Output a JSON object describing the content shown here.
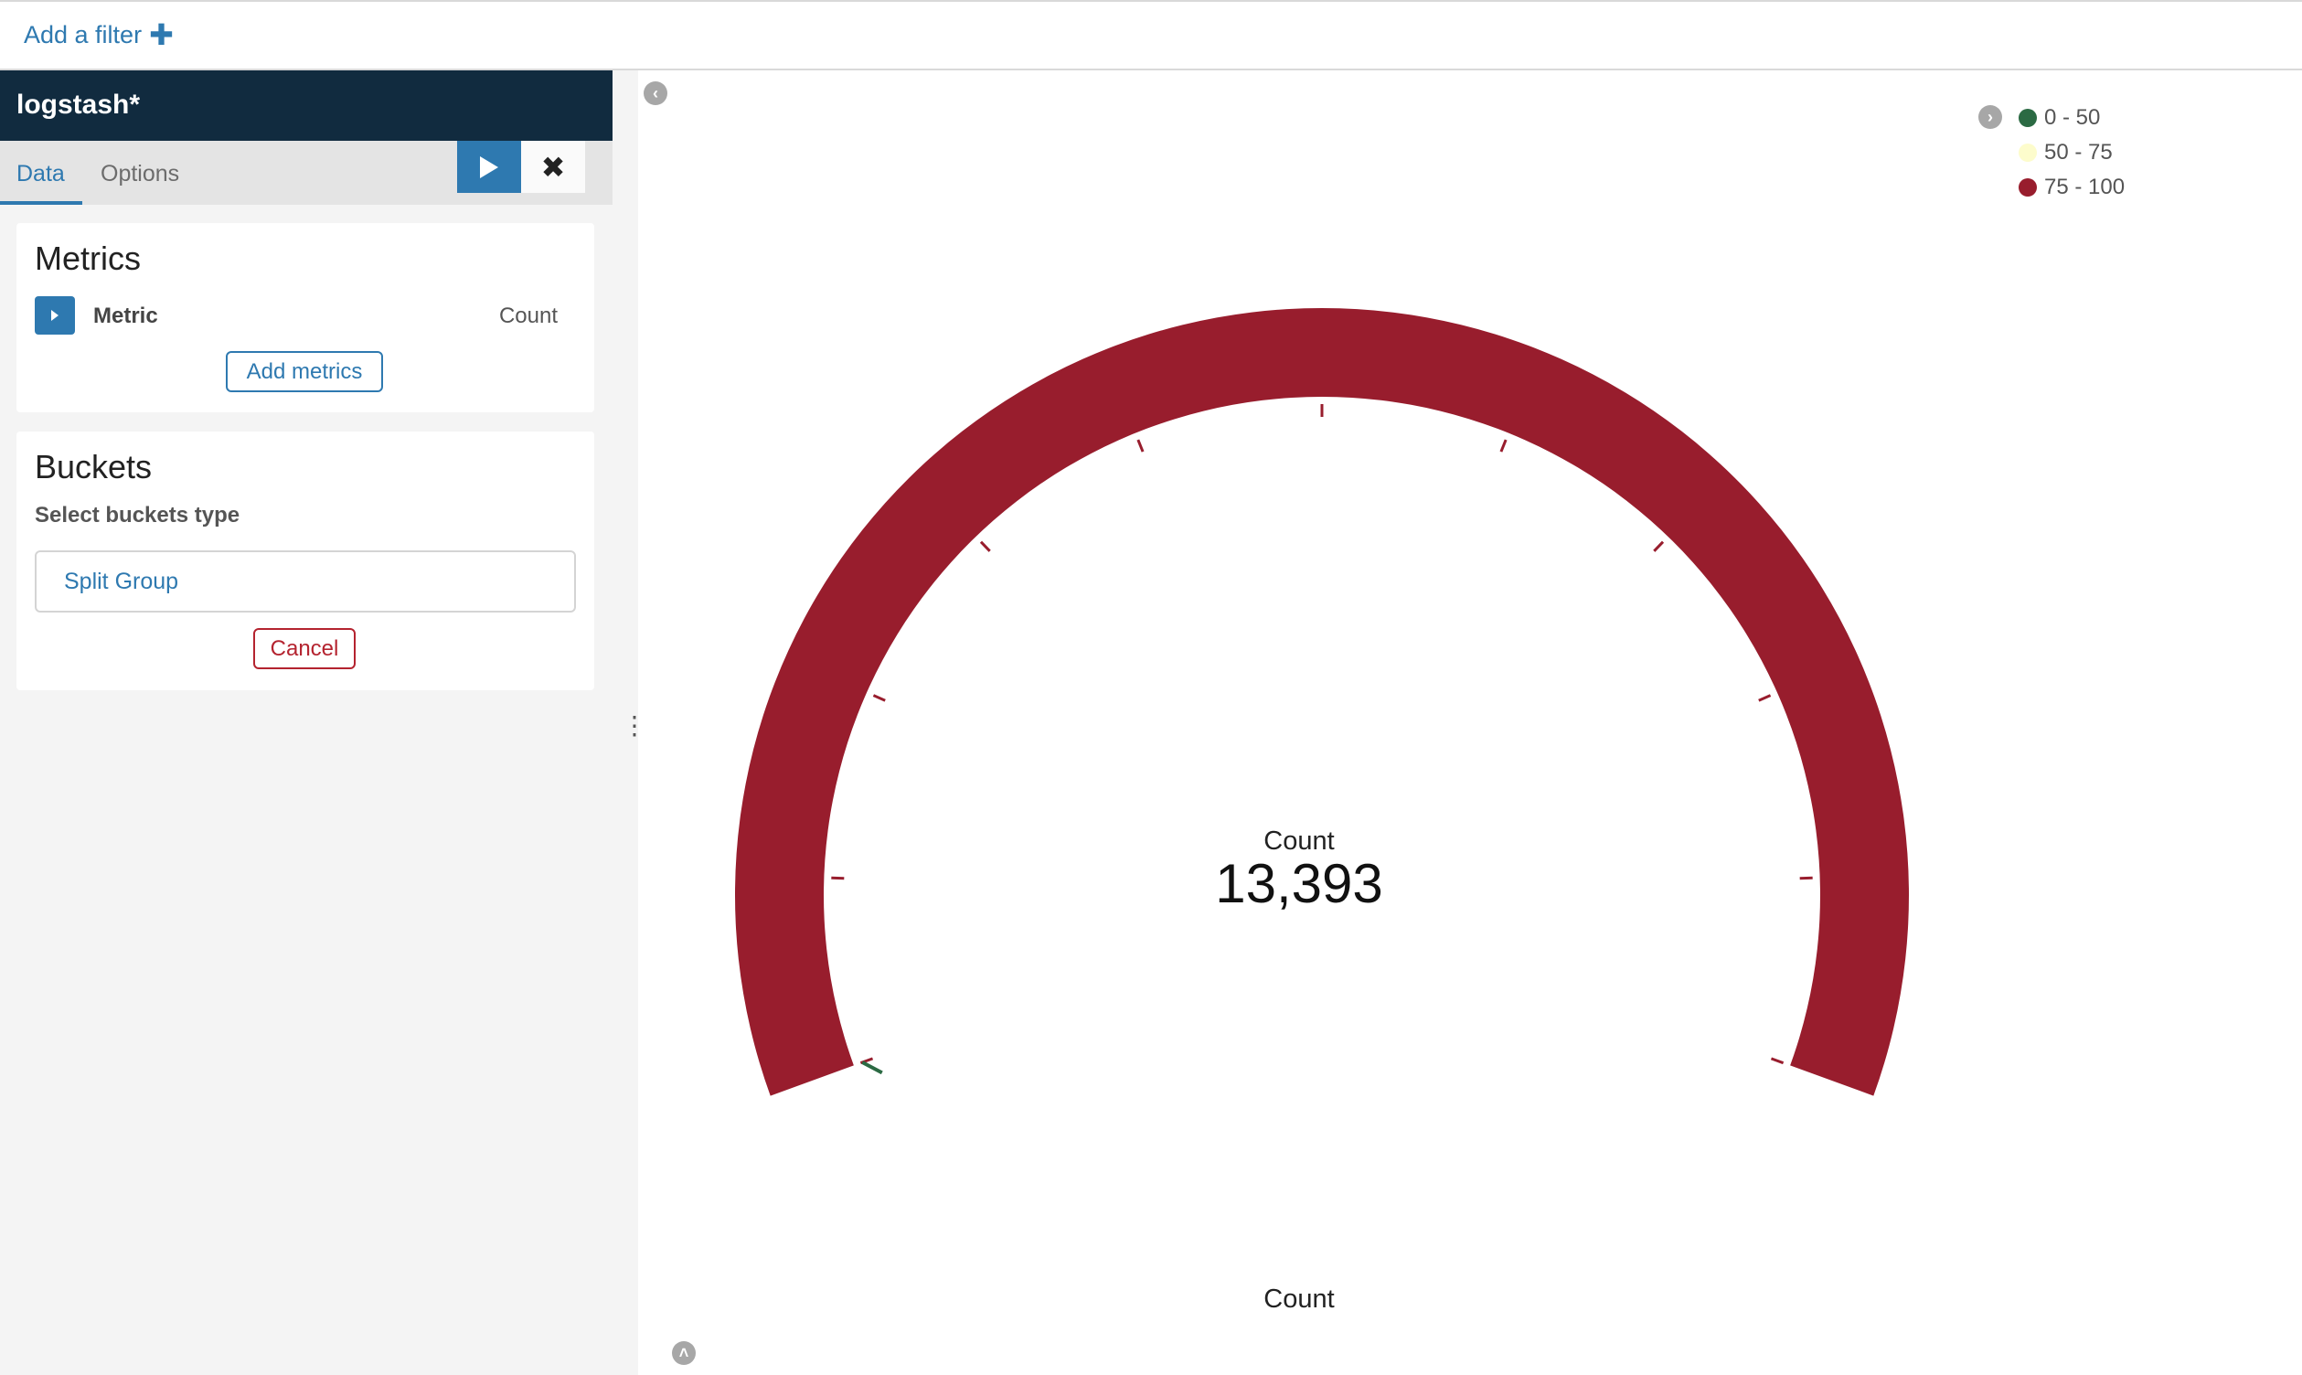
{
  "filterbar": {
    "add_filter_label": "Add a filter",
    "add_filter_icon": "plus-icon"
  },
  "sidebar": {
    "index_pattern": "logstash*",
    "tabs": [
      {
        "label": "Data",
        "active": true
      },
      {
        "label": "Options",
        "active": false
      }
    ],
    "apply_icon": "play-icon",
    "discard_icon": "close-icon",
    "metrics": {
      "title": "Metrics",
      "items": [
        {
          "label": "Metric",
          "value": "Count"
        }
      ],
      "add_label": "Add metrics"
    },
    "buckets": {
      "title": "Buckets",
      "select_label": "Select buckets type",
      "option": "Split Group",
      "cancel_label": "Cancel"
    }
  },
  "visualization": {
    "legend": [
      {
        "label": "0 - 50",
        "color": "#2b6a43"
      },
      {
        "label": "50 - 75",
        "color": "#fdfccc"
      },
      {
        "label": "75 - 100",
        "color": "#981d2d"
      }
    ],
    "gauge": {
      "label": "Count",
      "value": "13,393",
      "subtitle": "Count",
      "fill_fraction": 1.0,
      "arc_color": "#981d2d",
      "tick_color": "#981d2d",
      "start_marker_color": "#2b6a43"
    },
    "icons": {
      "collapse": "chevron-left-icon",
      "legend_toggle": "chevron-right-icon",
      "scroll_up": "chevron-up-icon"
    }
  }
}
